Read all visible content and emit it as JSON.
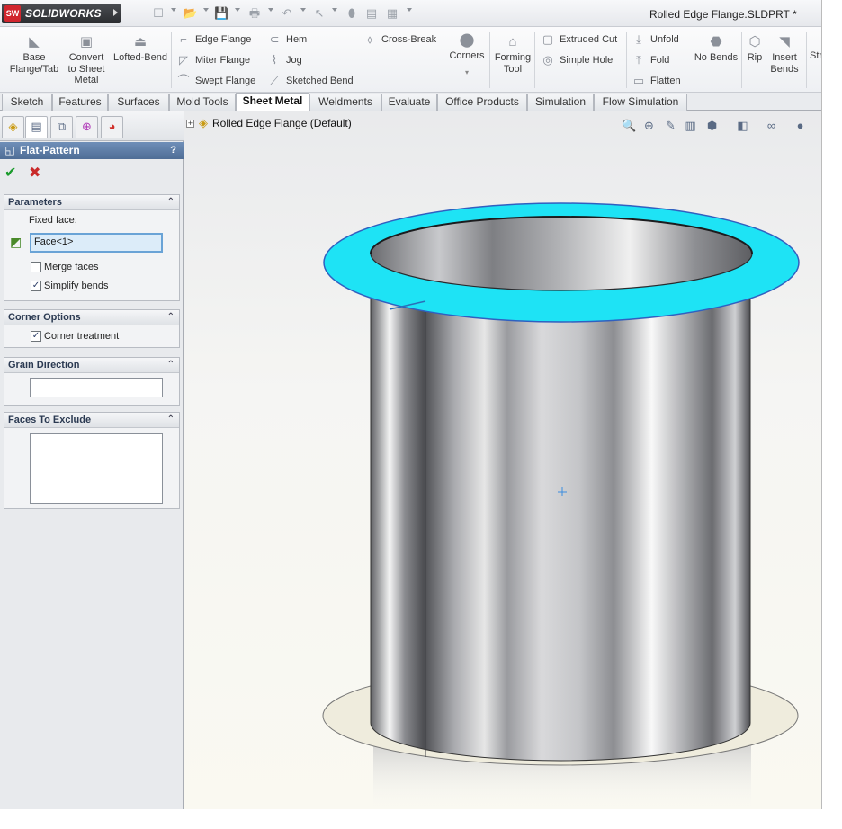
{
  "app": {
    "logo_text": "SOLIDWORKS",
    "logo_badge": "SW",
    "document_title": "Rolled Edge Flange.SLDPRT *"
  },
  "commands": {
    "base_flange": "Base Flange/Tab",
    "convert": "Convert to Sheet Metal",
    "lofted_bend": "Lofted-Bend",
    "edge_flange": "Edge Flange",
    "miter_flange": "Miter Flange",
    "swept_flange": "Swept Flange",
    "hem": "Hem",
    "jog": "Jog",
    "sketched_bend": "Sketched Bend",
    "cross_break": "Cross-Break",
    "corners": "Corners",
    "forming_tool": "Forming Tool",
    "extruded_cut": "Extruded Cut",
    "simple_hole": "Simple Hole",
    "unfold": "Unfold",
    "fold": "Fold",
    "flatten": "Flatten",
    "no_bends": "No Bends",
    "rip": "Rip",
    "insert_bends": "Insert Bends",
    "truncated": "Str"
  },
  "tabs": [
    "Sketch",
    "Features",
    "Surfaces",
    "Mold Tools",
    "Sheet Metal",
    "Weldments",
    "Evaluate",
    "Office Products",
    "Simulation",
    "Flow Simulation"
  ],
  "active_tab": "Sheet Metal",
  "property_manager": {
    "title": "Flat-Pattern",
    "help": "?",
    "groups": {
      "parameters": {
        "title": "Parameters",
        "fixed_face_label": "Fixed face:",
        "fixed_face_value": "Face<1>",
        "merge_faces_label": "Merge faces",
        "merge_faces_checked": false,
        "simplify_bends_label": "Simplify bends",
        "simplify_bends_checked": true
      },
      "corner_options": {
        "title": "Corner Options",
        "corner_treatment_label": "Corner treatment",
        "corner_treatment_checked": true
      },
      "grain_direction": {
        "title": "Grain Direction",
        "value": ""
      },
      "faces_to_exclude": {
        "title": "Faces To Exclude",
        "items": []
      }
    }
  },
  "viewport": {
    "tree_item": "Rolled Edge Flange  (Default)"
  },
  "colors": {
    "selected_face": "#1ee3f5",
    "header_blue": "#5a7aa6",
    "ok_green": "#1a9b2c",
    "cancel_red": "#c92a2a"
  },
  "glyphs": {
    "check": "✔",
    "cross": "✖",
    "checkmark_box": "✓",
    "collapse": "⌃"
  }
}
